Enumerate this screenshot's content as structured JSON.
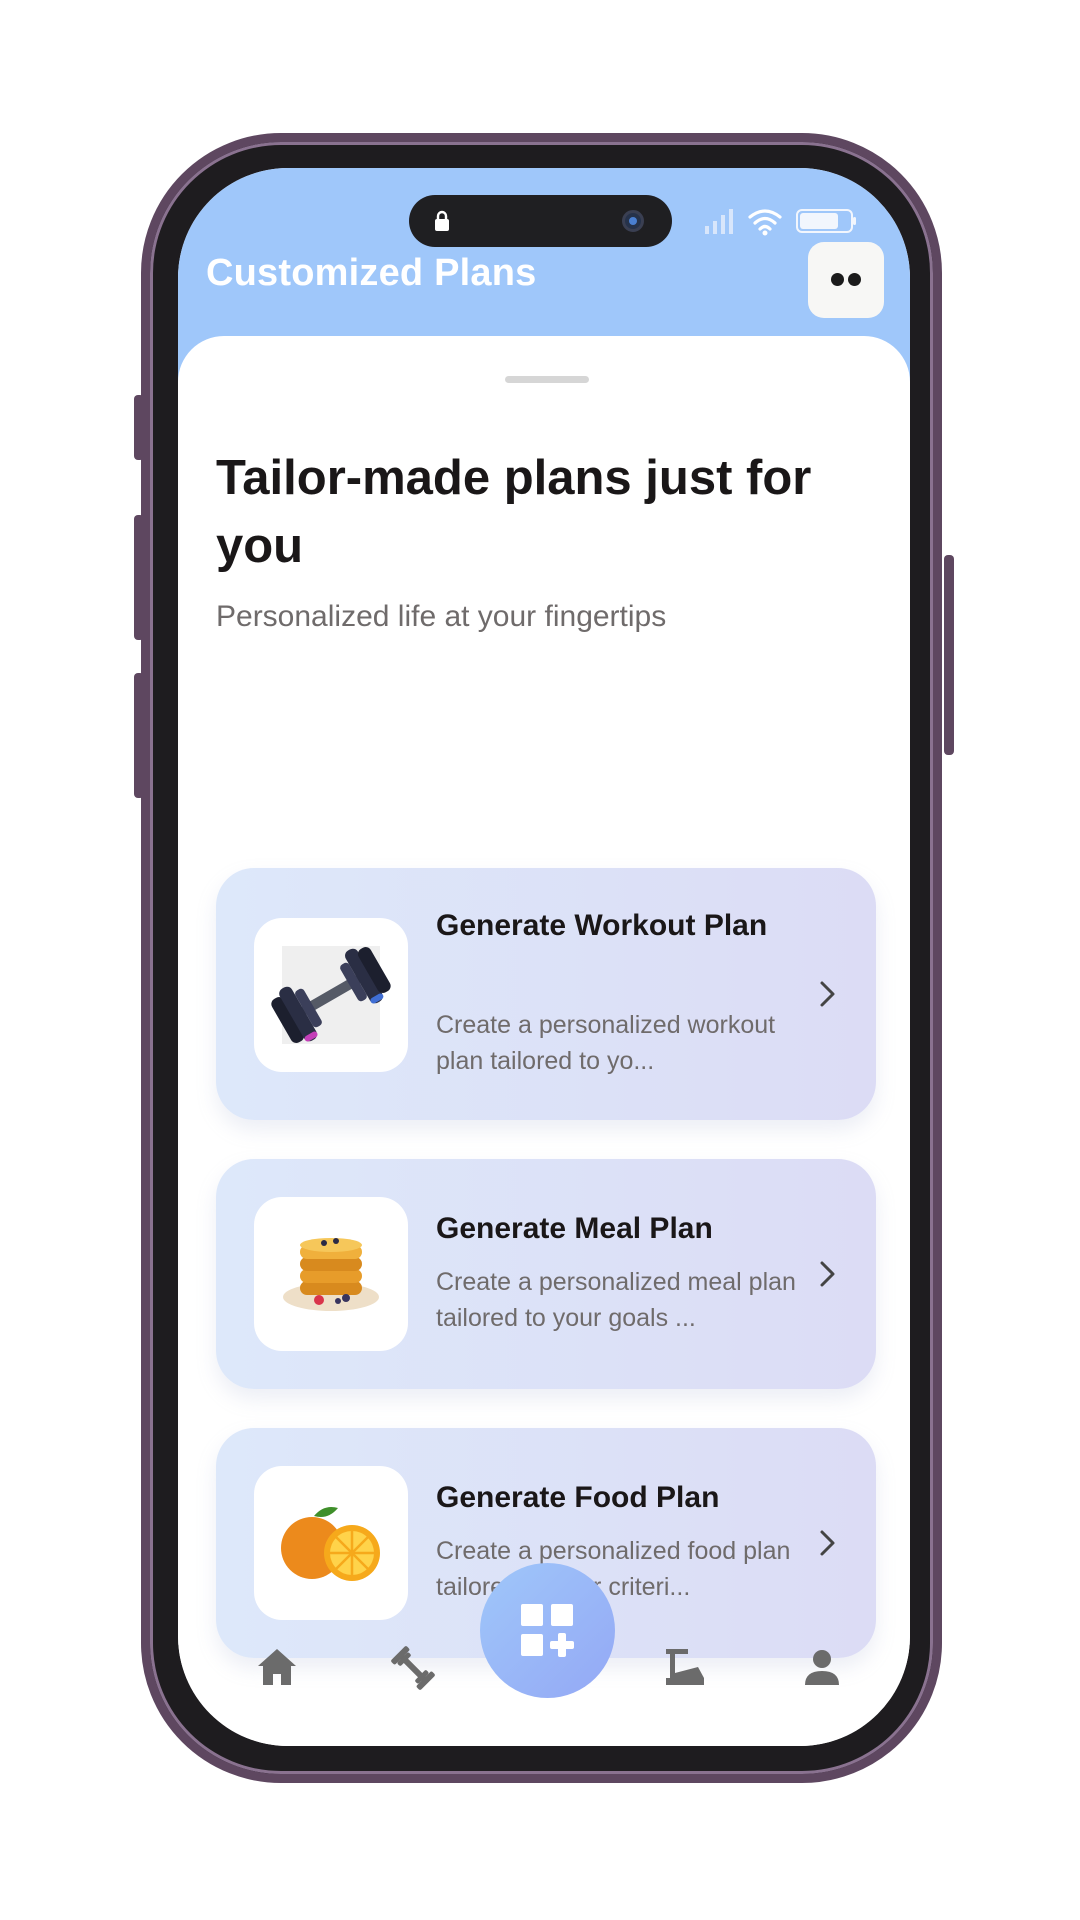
{
  "app": {
    "title": "Customized Plans"
  },
  "status_bar": {
    "icons": [
      "lock-icon",
      "camera-icon",
      "signal-icon",
      "wifi-icon",
      "battery-icon"
    ]
  },
  "header": {
    "menu_icon": "more-dots-icon",
    "background": "#9fc7fa"
  },
  "main": {
    "headline": "Tailor-made plans just for you",
    "subheadline": "Personalized life at your fingertips",
    "cards": [
      {
        "title": "Generate Workout Plan",
        "description": "Create a personalized workout plan tailored to yo...",
        "image": "dumbbell-image"
      },
      {
        "title": "Generate Meal Plan",
        "description": "Create a personalized meal plan tailored to your goals ...",
        "image": "pancakes-image"
      },
      {
        "title": "Generate Food Plan",
        "description": "Create a personalized food plan tailored to your criteri...",
        "image": "orange-image"
      }
    ]
  },
  "bottom_nav": {
    "items": [
      "home-icon",
      "dumbbell-icon",
      "add-plan-icon",
      "scale-icon",
      "profile-icon"
    ],
    "accent": "#9fc7fa",
    "icon_color": "#6b6b6b"
  }
}
